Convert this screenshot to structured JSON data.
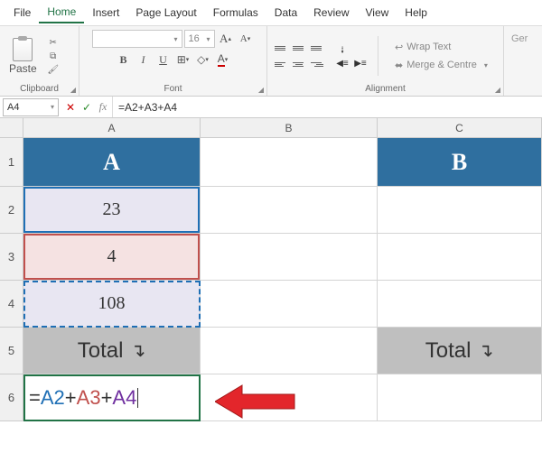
{
  "menu": {
    "items": [
      "File",
      "Home",
      "Insert",
      "Page Layout",
      "Formulas",
      "Data",
      "Review",
      "View",
      "Help"
    ],
    "active": 1
  },
  "ribbon": {
    "clipboard": {
      "paste": "Paste",
      "label": "Clipboard"
    },
    "font": {
      "label": "Font",
      "size": "16",
      "bold": "B",
      "italic": "I",
      "underline": "U",
      "inc": "A",
      "dec": "A"
    },
    "alignment": {
      "label": "Alignment",
      "wrap": "Wrap Text",
      "merge": "Merge & Centre"
    },
    "general": "Ger"
  },
  "namebox": "A4",
  "fx_label": "fx",
  "formula": "=A2+A3+A4",
  "cols": [
    "A",
    "B",
    "C"
  ],
  "rows": [
    "1",
    "2",
    "3",
    "4",
    "5",
    "6"
  ],
  "data": {
    "A": {
      "header": "A",
      "r2": "23",
      "r3": "4",
      "r4": "108",
      "total": "Total",
      "formula_parts": {
        "eq": "=",
        "r1": "A2",
        "r2": "A3",
        "r3": "A4",
        "plus": "+"
      }
    },
    "C": {
      "header": "B",
      "total": "Total"
    }
  }
}
